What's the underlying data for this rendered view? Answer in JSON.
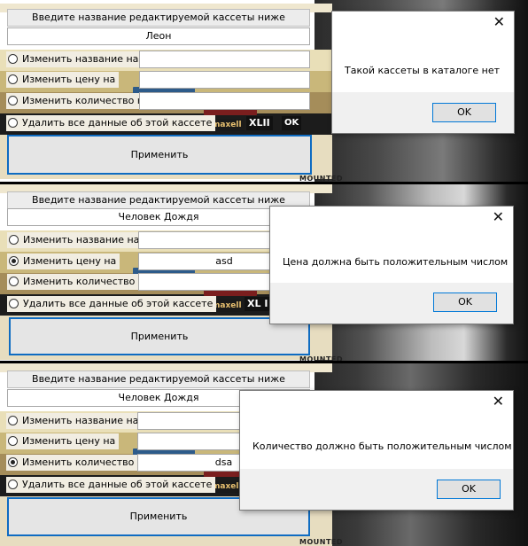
{
  "form": {
    "header_label": "Введите название редактируемой кассеты ниже",
    "apply_label": "Применить",
    "options": [
      "Изменить название на",
      "Изменить цену на",
      "Изменить количество на",
      "Удалить все данные об этой кассете"
    ]
  },
  "background": {
    "tags": [
      "MOUNTED",
      "maxell",
      "XLII",
      "XL I",
      "OK"
    ]
  },
  "panels": [
    {
      "cassette_name": "Леон",
      "selected_option": null,
      "price_value": "",
      "quantity_value": "",
      "dialog": {
        "message": "Такой кассеты в каталоге нет",
        "ok_label": "OK",
        "close": "✕"
      }
    },
    {
      "cassette_name": "Человек Дождя",
      "selected_option": 1,
      "price_value": "asd",
      "quantity_value": "",
      "dialog": {
        "message": "Цена должна быть положительным числом",
        "ok_label": "OK",
        "close": "✕"
      }
    },
    {
      "cassette_name": "Человек Дождя",
      "selected_option": 2,
      "price_value": "",
      "quantity_value": "dsa",
      "dialog": {
        "message": "Количество должно быть положительным числом",
        "ok_label": "OK",
        "close": "✕"
      }
    }
  ]
}
